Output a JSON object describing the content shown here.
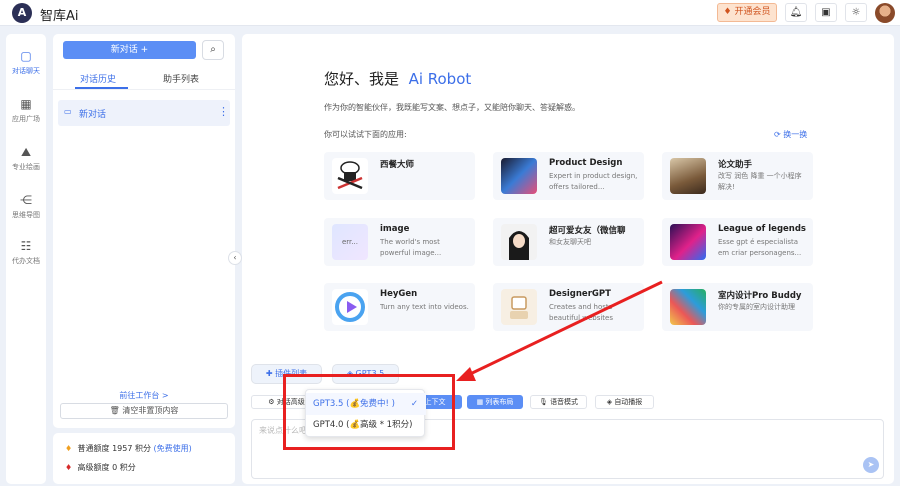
{
  "topbar": {
    "logo_text": "A",
    "app_title": "智库Ai",
    "vip_label": "开通会员",
    "bell_icon": "bell-icon",
    "gift_icon": "gift-icon",
    "theme_icon": "sun-icon"
  },
  "leftnav": [
    {
      "label": "对话聊天",
      "icon": "chat-icon",
      "active": true
    },
    {
      "label": "应用广场",
      "icon": "grid-icon"
    },
    {
      "label": "专业绘画",
      "icon": "mountain-icon"
    },
    {
      "label": "思维导图",
      "icon": "mindmap-icon"
    },
    {
      "label": "代办文档",
      "icon": "clipboard-icon"
    }
  ],
  "conversations": {
    "new_chat_label": "新对话 +",
    "tabs": [
      "对话历史",
      "助手列表"
    ],
    "items": [
      {
        "title": "新对话"
      }
    ],
    "workbench_link": "前往工作台 >",
    "clear_label": "清空非置顶内容"
  },
  "quota": {
    "normal_label": "普通额度 1957 积分",
    "normal_link": "(免费使用)",
    "premium_label": "高级额度 0 积分"
  },
  "main": {
    "greeting_prefix": "您好、我是",
    "greeting_name": "Ai Robot",
    "intro": "作为你的智能伙伴，我既能写文案、想点子，又能陪你聊天、答疑解惑。",
    "try_label": "你可以试试下面的应用:",
    "refresh_label": "换一换",
    "apps": [
      {
        "title": "西餐大师",
        "desc": ""
      },
      {
        "title": "Product Design",
        "desc": "Expert in product design, offers tailored..."
      },
      {
        "title": "论文助手",
        "desc": "改写 润色 降重 一个小程序解决!"
      },
      {
        "title": "image",
        "desc": "The world's most powerful image...",
        "thumb_text": "err..."
      },
      {
        "title": "超可爱女友（微信聊",
        "desc": "和女友聊天吧"
      },
      {
        "title": "League of legends",
        "desc": "Esse gpt é especialista em criar personagens..."
      },
      {
        "title": "HeyGen",
        "desc": "Turn any text into videos."
      },
      {
        "title": "DesignerGPT",
        "desc": "Creates and hosts beautiful websites"
      },
      {
        "title": "室内设计Pro Buddy",
        "desc": "你的专属的室内设计助理"
      }
    ],
    "plugins_label": "插件列表",
    "model_label": "GPT3.5",
    "chips": [
      "对话高级配",
      "上下文",
      "列表布局",
      "语音模式",
      "自动播报"
    ],
    "input_placeholder": "来说点什么吧..."
  },
  "model_dropdown": {
    "options": [
      {
        "label": "GPT3.5 (💰免费中! )",
        "selected": true
      },
      {
        "label": "GPT4.0 (💰高级 * 1积分)"
      }
    ]
  },
  "colors": {
    "accent": "#3c6fe8",
    "annotation_red": "#e82020"
  }
}
